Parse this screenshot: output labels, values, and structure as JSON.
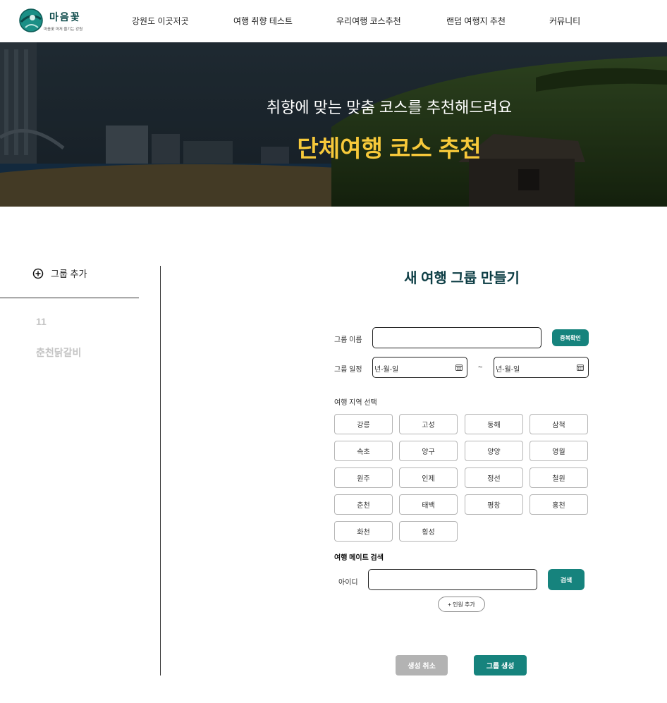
{
  "brand": {
    "name": "마음꽃",
    "tagline": "마음꽃 마저 즐기는 강원",
    "accent": "#16837d"
  },
  "nav": {
    "items": [
      "강원도 이곳저곳",
      "여행 취향 테스트",
      "우리여행 코스추천",
      "랜덤 여행지 추천",
      "커뮤니티"
    ]
  },
  "hero": {
    "subtitle": "취향에 맞는 맞춤 코스를 추천해드려요",
    "title": "단체여행 코스 추천",
    "title_color": "#f7c93a"
  },
  "sidebar": {
    "add_label": "그룹 추가",
    "groups": [
      "11",
      "춘천닭갈비"
    ]
  },
  "form": {
    "title": "새 여행 그룹 만들기",
    "group_name_label": "그룹 이름",
    "group_name_value": "",
    "duplicate_check_label": "중복확인",
    "schedule_label": "그룹 일정",
    "date_start_placeholder": "년-월-일",
    "date_end_placeholder": "년-월-일",
    "date_separator": "~",
    "region_label": "여행 지역 선택",
    "regions": [
      "강릉",
      "고성",
      "동해",
      "삼척",
      "속초",
      "양구",
      "양양",
      "영월",
      "원주",
      "인제",
      "정선",
      "철원",
      "춘천",
      "태백",
      "평창",
      "홍천",
      "화천",
      "횡성"
    ],
    "mate_search_label": "여행 메이트 검색",
    "id_label": "아이디",
    "id_value": "",
    "search_label": "검색",
    "add_member_label": "+ 인원 추가",
    "cancel_label": "생성 취소",
    "create_label": "그룹 생성"
  }
}
